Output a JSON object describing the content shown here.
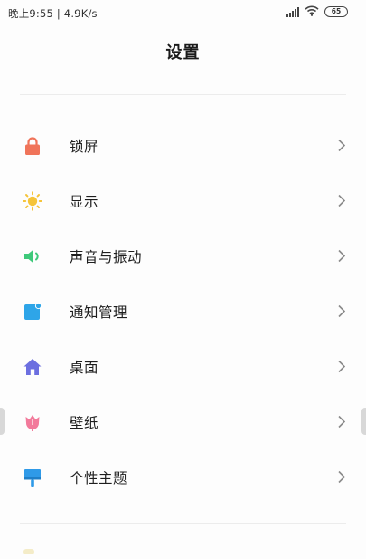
{
  "status_bar": {
    "time_speed": "晚上9:55 | 4.9K/s",
    "battery": "65"
  },
  "header": {
    "title": "设置"
  },
  "settings": {
    "items": [
      {
        "label": "锁屏",
        "icon": "lock-icon",
        "color": "#f0745a"
      },
      {
        "label": "显示",
        "icon": "sun-icon",
        "color": "#f5c43a"
      },
      {
        "label": "声音与振动",
        "icon": "speaker-icon",
        "color": "#3ec97a"
      },
      {
        "label": "通知管理",
        "icon": "notification-icon",
        "color": "#2ea5e8"
      },
      {
        "label": "桌面",
        "icon": "home-icon",
        "color": "#6c6fe0"
      },
      {
        "label": "壁纸",
        "icon": "tulip-icon",
        "color": "#f27a9b"
      },
      {
        "label": "个性主题",
        "icon": "paint-brush-icon",
        "color": "#2f9ae8"
      }
    ]
  }
}
